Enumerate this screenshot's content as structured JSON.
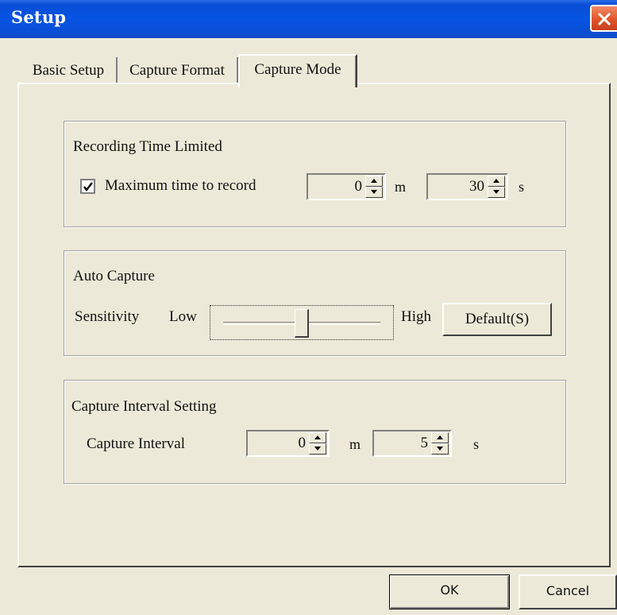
{
  "window": {
    "title": "Setup",
    "titlebar_color": "#0554e3",
    "close_icon": "close-x-icon"
  },
  "tabs": [
    {
      "label": "Basic Setup",
      "selected": false
    },
    {
      "label": "Capture Format",
      "selected": false
    },
    {
      "label": "Capture Mode",
      "selected": true
    }
  ],
  "recording": {
    "group_label": "Recording Time Limited",
    "checkbox_label": "Maximum time to record",
    "checked": true,
    "minutes_value": "0",
    "minutes_unit": "m",
    "seconds_value": "30",
    "seconds_unit": "s"
  },
  "auto_capture": {
    "group_label": "Auto Capture",
    "sensitivity_label": "Sensitivity",
    "low_label": "Low",
    "high_label": "High",
    "slider_level": 0.5,
    "default_button": "Default(S)"
  },
  "interval": {
    "group_label": "Capture Interval Setting",
    "interval_label": "Capture Interval",
    "minutes_value": "0",
    "minutes_unit": "m",
    "seconds_value": "5",
    "seconds_unit": "s"
  },
  "buttons": {
    "ok": "OK",
    "cancel": "Cancel"
  }
}
